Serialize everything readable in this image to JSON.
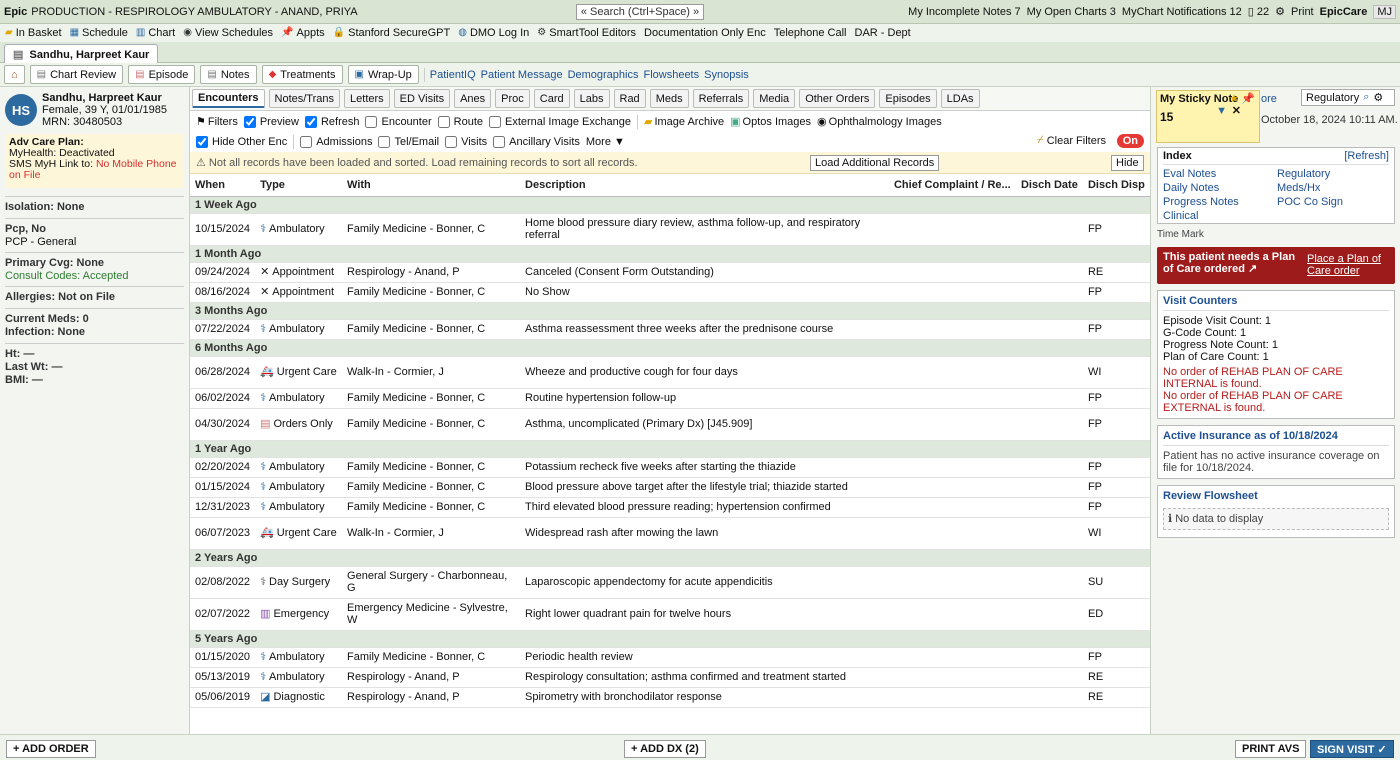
{
  "topbar": {
    "epic": "Epic",
    "title": "PRODUCTION - RESPIROLOGY AMBULATORY - ANAND, PRIYA",
    "search": "« Search (Ctrl+Space) »",
    "incomplete_notes": "My Incomplete Notes 7",
    "open_charts": "My Open Charts 3",
    "mychart_notif": "MyChart Notifications 12",
    "count22": "22",
    "print": "Print",
    "epiccare": "EpicCare",
    "user_initials": "MJ"
  },
  "menubar": [
    {
      "label": "In Basket",
      "icon": "folder-icon"
    },
    {
      "label": "Schedule",
      "icon": "calendar-icon"
    },
    {
      "label": "Chart",
      "icon": "chart-icon"
    },
    {
      "label": "View Schedules",
      "icon": "eye-icon"
    },
    {
      "label": "Appts",
      "icon": "pin-icon"
    },
    {
      "label": "Stanford SecureGPT",
      "icon": "lock-icon"
    },
    {
      "label": "DMO Log In",
      "icon": "globe-icon"
    },
    {
      "label": "SmartTool Editors",
      "icon": "gear-icon"
    },
    {
      "label": "Documentation Only Enc",
      "icon": ""
    },
    {
      "label": "Telephone Call",
      "icon": ""
    },
    {
      "label": "DAR - Dept",
      "icon": ""
    }
  ],
  "patient_tab": "Sandhu, Harpreet Kaur",
  "actbar": {
    "buttons": [
      "Chart Review",
      "Episode",
      "Notes",
      "Treatments",
      "Wrap-Up"
    ],
    "links": [
      "PatientIQ",
      "Patient Message",
      "Demographics",
      "Flowsheets",
      "Synopsis"
    ]
  },
  "patient": {
    "initials": "HS",
    "name": "Sandhu, Harpreet Kaur",
    "demo": "Female, 39 Y, 01/01/1985",
    "mrn": "MRN: 30480503",
    "careplan_title": "Adv Care Plan:",
    "myhealth": "MyHealth: Deactivated",
    "sms": "SMS MyH Link to:",
    "sms_value": "No Mobile Phone on File",
    "isolation": "Isolation: None",
    "pcp_no": "Pcp, No",
    "pcp_general": "PCP - General",
    "primary_cvg": "Primary Cvg: None",
    "consult": "Consult Codes: Accepted",
    "allergies": "Allergies: Not on File",
    "meds": "Current Meds: 0",
    "infection": "Infection: None",
    "ht": "Ht: —",
    "wt": "Last Wt: —",
    "bmi": "BMI: —"
  },
  "subtabs": [
    "Encounters",
    "Notes/Trans",
    "Letters",
    "ED Visits",
    "Anes",
    "Proc",
    "Card",
    "Labs",
    "Rad",
    "Meds",
    "Referrals",
    "Media",
    "Other Orders",
    "Episodes",
    "LDAs"
  ],
  "filters": {
    "filters": "Filters",
    "preview": "Preview",
    "refresh": "Refresh",
    "encounter": "Encounter",
    "route": "Route",
    "external": "External Image Exchange",
    "image_archive": "Image Archive",
    "optos": "Optos Images",
    "ophth": "Ophthalmology Images",
    "hide_other": "Hide Other Enc",
    "admissions": "Admissions",
    "tel_email": "Tel/Email",
    "visits": "Visits",
    "ancillary": "Ancillary Visits",
    "more": "More ▼",
    "clear": "Clear Filters",
    "on": "On"
  },
  "warning": {
    "text": "⚠ Not all records have been loaded and sorted. Load remaining records to sort all records.",
    "load": "Load Additional Records",
    "hide": "Hide"
  },
  "columns": [
    "When",
    "Type",
    "With",
    "Description",
    "Chief Complaint / Re...",
    "Disch Date",
    "Disch Disp"
  ],
  "groups": [
    {
      "label": "1 Week Ago",
      "rows": [
        {
          "when": "10/15/2024",
          "icon": "stethoscope-icon",
          "type": "Ambulatory",
          "with": "Family Medicine - Bonner, C",
          "desc": "Home blood pressure diary review, asthma follow-up, and respiratory referral",
          "disp": "FP",
          "tall": true
        }
      ]
    },
    {
      "label": "1 Month Ago",
      "rows": [
        {
          "when": "09/24/2024",
          "icon": "x-icon",
          "type": "Appointment",
          "with": "Respirology - Anand, P",
          "desc": "Canceled (Consent Form Outstanding)",
          "disp": "RE"
        },
        {
          "when": "08/16/2024",
          "icon": "x-icon",
          "type": "Appointment",
          "with": "Family Medicine - Bonner, C",
          "desc": "No Show",
          "disp": "FP"
        }
      ]
    },
    {
      "label": "3 Months Ago",
      "rows": [
        {
          "when": "07/22/2024",
          "icon": "stethoscope-icon",
          "type": "Ambulatory",
          "with": "Family Medicine - Bonner, C",
          "desc": "Asthma reassessment three weeks after the prednisone course",
          "disp": "FP"
        }
      ]
    },
    {
      "label": "6 Months Ago",
      "rows": [
        {
          "when": "06/28/2024",
          "icon": "ambulance-icon",
          "type": "Urgent Care",
          "with": "Walk-In - Cormier, J",
          "desc": "Wheeze and productive cough for four days",
          "disp": "WI",
          "tall": true
        },
        {
          "when": "06/02/2024",
          "icon": "stethoscope-icon",
          "type": "Ambulatory",
          "with": "Family Medicine - Bonner, C",
          "desc": "Routine hypertension follow-up",
          "disp": "FP"
        },
        {
          "when": "04/30/2024",
          "icon": "clipboard-icon",
          "type": "Orders Only",
          "with": "Family Medicine - Bonner, C",
          "desc": "Asthma, uncomplicated (Primary Dx) [J45.909]",
          "disp": "FP",
          "tall": true
        }
      ]
    },
    {
      "label": "1 Year Ago",
      "rows": [
        {
          "when": "02/20/2024",
          "icon": "stethoscope-icon",
          "type": "Ambulatory",
          "with": "Family Medicine - Bonner, C",
          "desc": "Potassium recheck five weeks after starting the thiazide",
          "disp": "FP"
        },
        {
          "when": "01/15/2024",
          "icon": "stethoscope-icon",
          "type": "Ambulatory",
          "with": "Family Medicine - Bonner, C",
          "desc": "Blood pressure above target after the lifestyle trial; thiazide started",
          "disp": "FP"
        },
        {
          "when": "12/31/2023",
          "icon": "stethoscope-icon",
          "type": "Ambulatory",
          "with": "Family Medicine - Bonner, C",
          "desc": "Third elevated blood pressure reading; hypertension confirmed",
          "disp": "FP"
        },
        {
          "when": "06/07/2023",
          "icon": "ambulance-icon",
          "type": "Urgent Care",
          "with": "Walk-In - Cormier, J",
          "desc": "Widespread rash after mowing the lawn",
          "disp": "WI",
          "tall": true
        }
      ]
    },
    {
      "label": "2 Years Ago",
      "rows": [
        {
          "when": "02/08/2022",
          "icon": "scalpel-icon",
          "type": "Day Surgery",
          "with": "General Surgery - Charbonneau, G",
          "desc": "Laparoscopic appendectomy for acute appendicitis",
          "disp": "SU",
          "tall": true
        },
        {
          "when": "02/07/2022",
          "icon": "hospital-icon",
          "type": "Emergency",
          "with": "Emergency Medicine - Sylvestre, W",
          "desc": "Right lower quadrant pain for twelve hours",
          "disp": "ED",
          "tall": true
        }
      ]
    },
    {
      "label": "5 Years Ago",
      "rows": [
        {
          "when": "01/15/2020",
          "icon": "stethoscope-icon",
          "type": "Ambulatory",
          "with": "Family Medicine - Bonner, C",
          "desc": "Periodic health review",
          "disp": "FP"
        },
        {
          "when": "05/13/2019",
          "icon": "stethoscope-icon",
          "type": "Ambulatory",
          "with": "Respirology - Anand, P",
          "desc": "Respirology consultation; asthma confirmed and treatment started",
          "disp": "RE"
        },
        {
          "when": "05/06/2019",
          "icon": "graph-icon",
          "type": "Diagnostic",
          "with": "Respirology - Anand, P",
          "desc": "Spirometry with bronchodilator response",
          "disp": "RE"
        }
      ]
    }
  ],
  "right": {
    "sticky_title": "My Sticky Note",
    "sticky_count": "15",
    "more": "ore",
    "regulatory": "Regulatory",
    "date_text": "October 18, 2024 10:11 AM.",
    "index_title": "Index",
    "index_refresh": "[Refresh]",
    "index_links": [
      "Eval Notes",
      "Regulatory",
      "Daily Notes",
      "Meds/Hx",
      "Progress Notes",
      "POC Co Sign",
      "Clinical"
    ],
    "time_mark": "Time Mark",
    "plan_alert": "This patient needs a Plan of Care ordered ↗",
    "plan_link": "Place a Plan of Care order",
    "visit_title": "Visit Counters",
    "visit_lines": [
      "Episode Visit Count: 1",
      "G-Code Count: 1",
      "Progress Note Count: 1",
      "Plan of Care Count: 1"
    ],
    "visit_warn1": "No order of REHAB PLAN OF CARE INTERNAL is found.",
    "visit_warn2": "No order of REHAB PLAN OF CARE EXTERNAL is found.",
    "ins_title": "Active Insurance as of 10/18/2024",
    "ins_text": "Patient has no active insurance coverage on file for 10/18/2024.",
    "flow_title": "Review Flowsheet",
    "flow_nodata": "ℹ No data to display"
  },
  "bottom": {
    "add_order": "+ ADD ORDER",
    "add_dx": "+ ADD DX (2)",
    "print_avs": "PRINT AVS",
    "sign_visit": "SIGN VISIT ✓"
  }
}
